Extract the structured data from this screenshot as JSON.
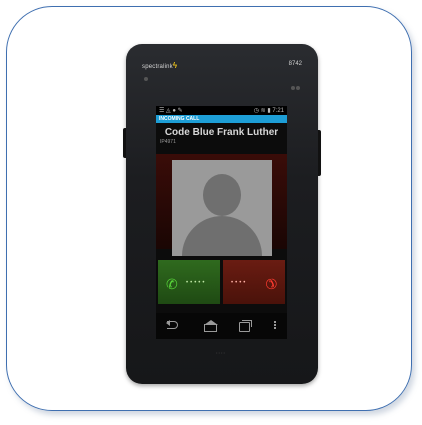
{
  "device": {
    "brand": "spectralink",
    "extension": "8742"
  },
  "status_bar": {
    "left_icons": "☰ ◬ ● ✎",
    "right_icons": "◷ ≋ ▮ 7:21"
  },
  "call": {
    "banner": "INCOMING CALL",
    "caller_name": "Code Blue Frank Luther",
    "caller_sub": "IP4971"
  },
  "actions": {
    "answer_icon": "phone-answer-icon",
    "decline_icon": "phone-decline-icon",
    "answer_color": "#58d63a",
    "decline_color": "#ff3b30",
    "banner_color": "#1d9ed6",
    "frame_color": "#3f6fb0"
  },
  "navbar": {
    "buttons": [
      "back",
      "home",
      "recent-apps",
      "menu"
    ]
  }
}
